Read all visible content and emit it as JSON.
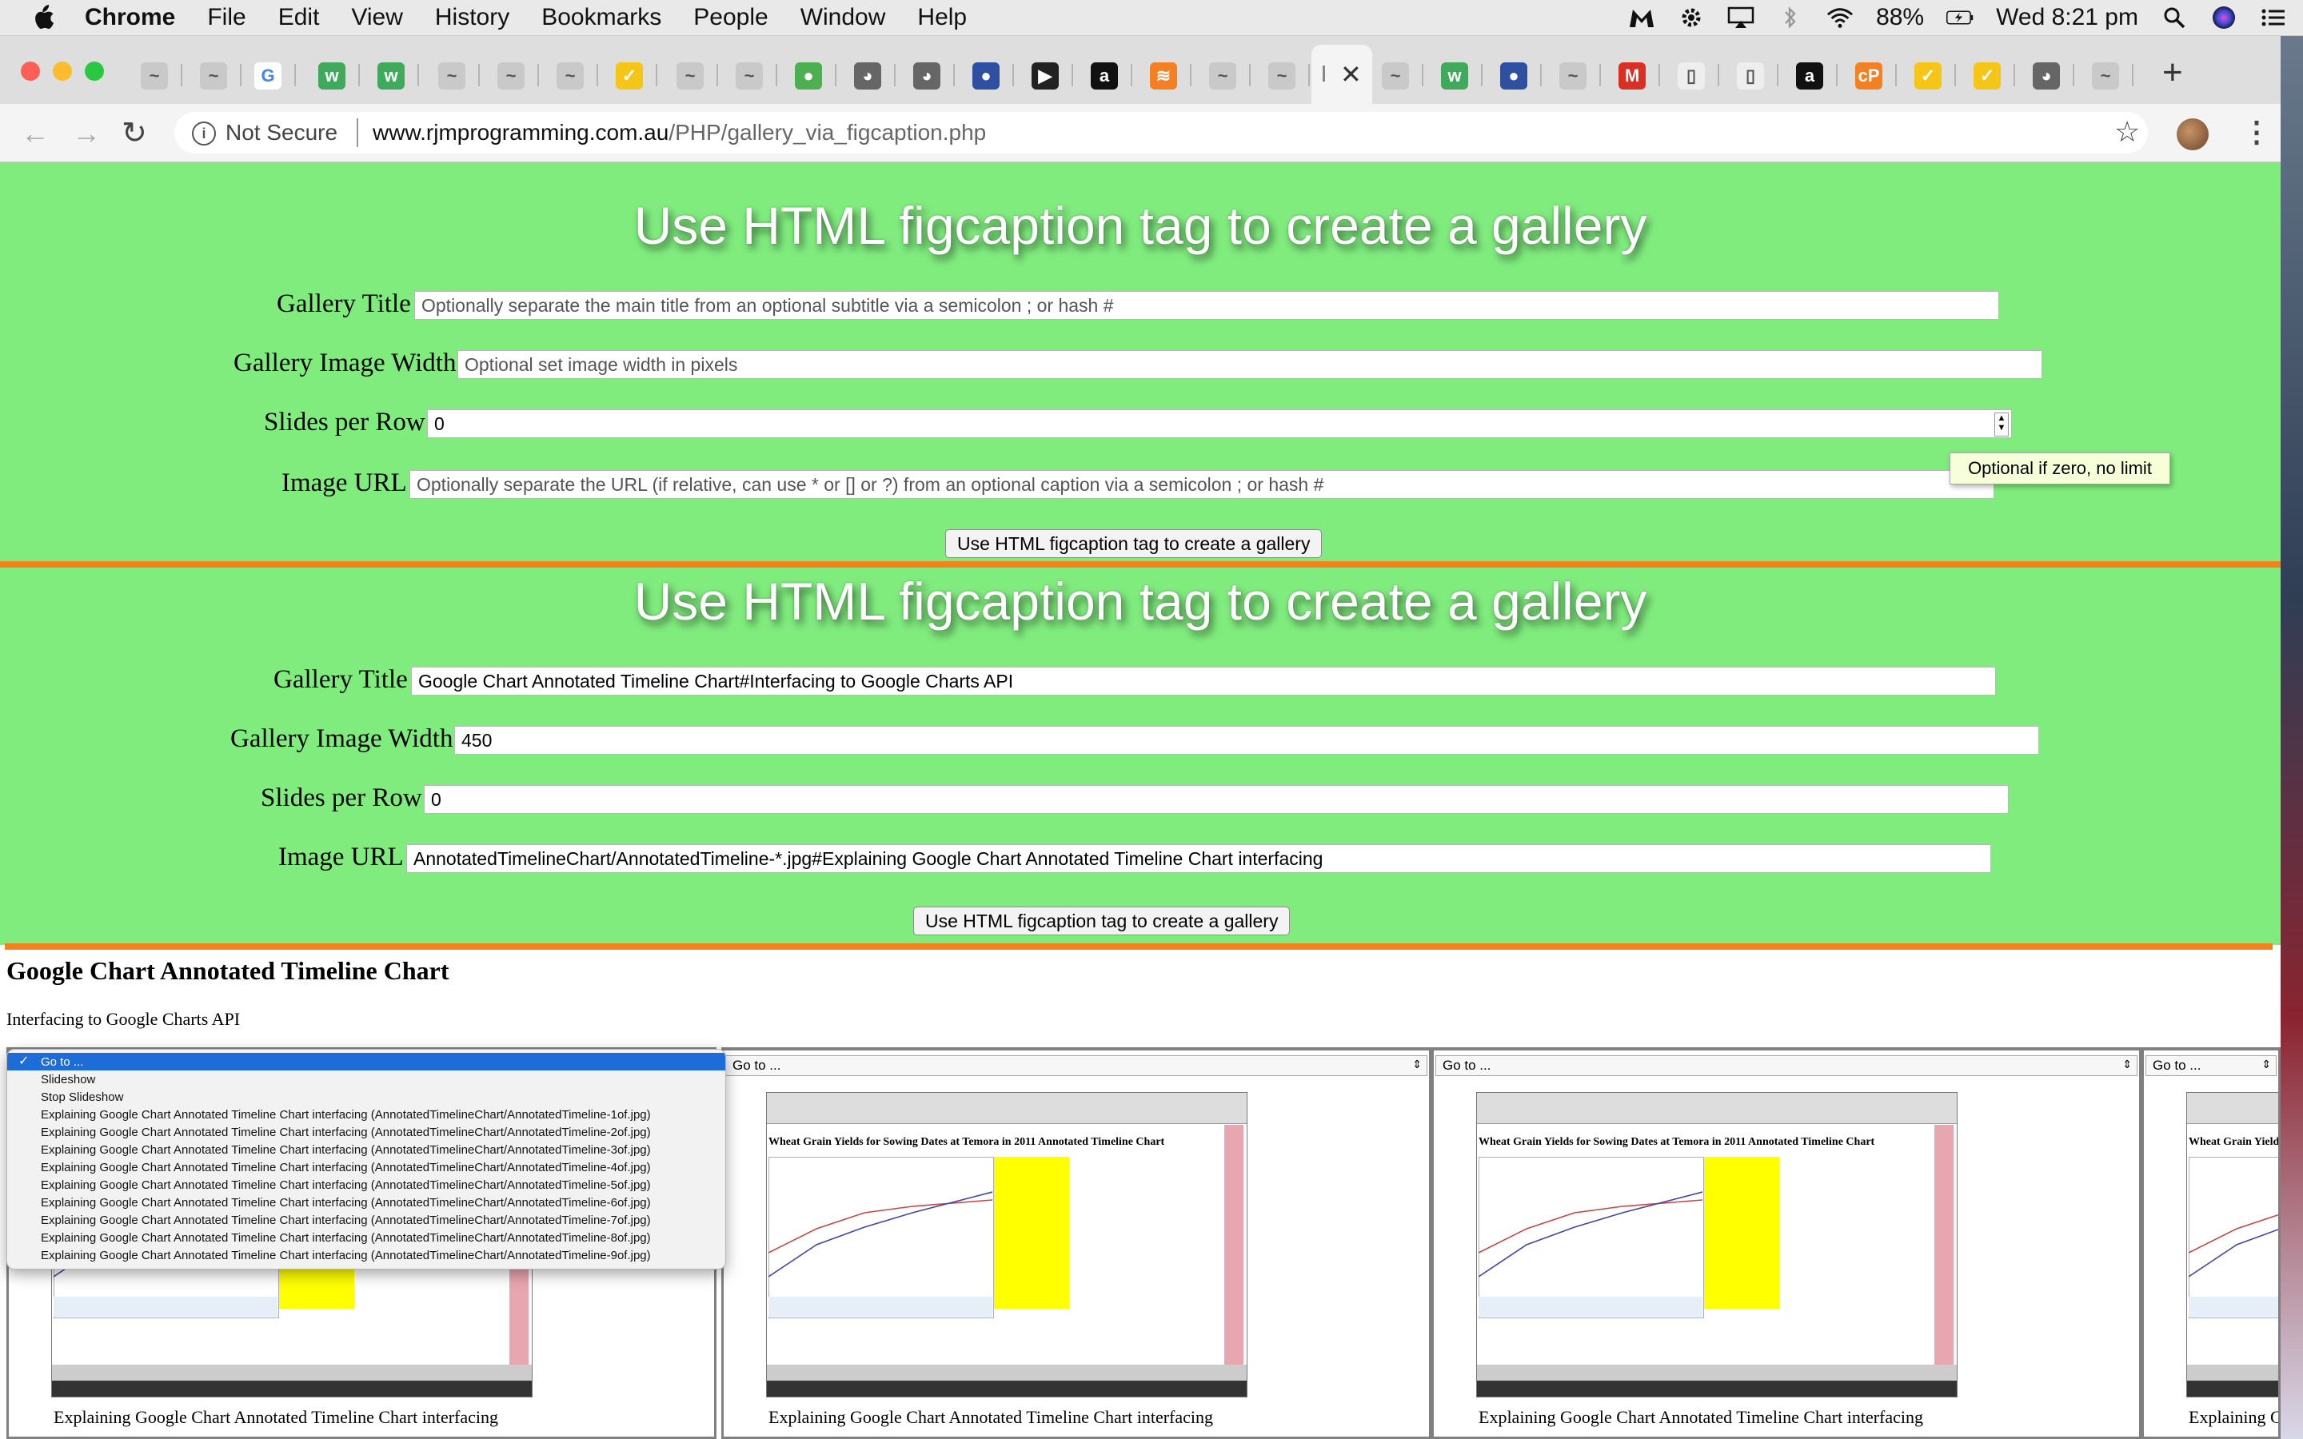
{
  "menubar": {
    "app_name": "Chrome",
    "items": [
      "File",
      "Edit",
      "View",
      "History",
      "Bookmarks",
      "People",
      "Window",
      "Help"
    ],
    "battery": "88%",
    "clock": "Wed 8:21 pm"
  },
  "browser": {
    "security_label": "Not Secure",
    "url_host": "www.rjmprogramming.com.au",
    "url_path": "/PHP/gallery_via_figcaption.php"
  },
  "form1": {
    "heading": "Use HTML figcaption tag to create a gallery",
    "title_label": "Gallery Title",
    "title_value": "",
    "title_placeholder": "Optionally separate the main title from an optional subtitle via a semicolon ; or hash #",
    "width_label": "Gallery Image Width",
    "width_value": "",
    "width_placeholder": "Optional set image width in pixels",
    "slides_label": "Slides per Row",
    "slides_value": "0",
    "url_label": "Image URL",
    "url_value": "",
    "url_placeholder": "Optionally separate the URL (if relative, can use * or [] or ?) from an optional caption via a semicolon ; or hash #",
    "submit_label": "Use HTML figcaption tag to create a gallery",
    "tooltip": "Optional if zero, no limit"
  },
  "form2": {
    "heading": "Use HTML figcaption tag to create a gallery",
    "title_label": "Gallery Title",
    "title_value": "Google Chart Annotated Timeline Chart#Interfacing to Google Charts API",
    "width_label": "Gallery Image Width",
    "width_value": "450",
    "slides_label": "Slides per Row",
    "slides_value": "0",
    "url_label": "Image URL",
    "url_value": "AnnotatedTimelineChart/AnnotatedTimeline-*.jpg#Explaining Google Chart Annotated Timeline Chart interfacing",
    "submit_label": "Use HTML figcaption tag to create a gallery"
  },
  "gallery": {
    "title": "Google Chart Annotated Timeline Chart",
    "subtitle": "Interfacing to Google Charts API",
    "goto_label": "Go to ...",
    "thumb_heading": "Wheat Grain Yields for Sowing Dates at Temora in 2011 Annotated Timeline Chart",
    "caption": "Explaining Google Chart Annotated Timeline Chart interfacing",
    "caption_partial": "Explaining G",
    "thumb_heading_partial": "Wheat Grain Yield"
  },
  "dropdown": {
    "options": [
      "Go to ...",
      "Slideshow",
      "Stop Slideshow",
      "Explaining Google Chart Annotated Timeline Chart interfacing (AnnotatedTimelineChart/AnnotatedTimeline-1of.jpg)",
      "Explaining Google Chart Annotated Timeline Chart interfacing (AnnotatedTimelineChart/AnnotatedTimeline-2of.jpg)",
      "Explaining Google Chart Annotated Timeline Chart interfacing (AnnotatedTimelineChart/AnnotatedTimeline-3of.jpg)",
      "Explaining Google Chart Annotated Timeline Chart interfacing (AnnotatedTimelineChart/AnnotatedTimeline-4of.jpg)",
      "Explaining Google Chart Annotated Timeline Chart interfacing (AnnotatedTimelineChart/AnnotatedTimeline-5of.jpg)",
      "Explaining Google Chart Annotated Timeline Chart interfacing (AnnotatedTimelineChart/AnnotatedTimeline-6of.jpg)",
      "Explaining Google Chart Annotated Timeline Chart interfacing (AnnotatedTimelineChart/AnnotatedTimeline-7of.jpg)",
      "Explaining Google Chart Annotated Timeline Chart interfacing (AnnotatedTimelineChart/AnnotatedTimeline-8of.jpg)",
      "Explaining Google Chart Annotated Timeline Chart interfacing (AnnotatedTimelineChart/AnnotatedTimeline-9of.jpg)"
    ]
  },
  "colors": {
    "panel_green": "#80ec7e",
    "rule_orange": "#f4821f",
    "select_blue": "#1d6cd8"
  },
  "icons": {
    "menubar_right": [
      "malwarebytes-icon",
      "gear-badge-icon",
      "airplay-icon",
      "bluetooth-icon",
      "wifi-icon",
      "battery-icon",
      "search-icon",
      "siri-icon",
      "menu-list-icon"
    ]
  }
}
